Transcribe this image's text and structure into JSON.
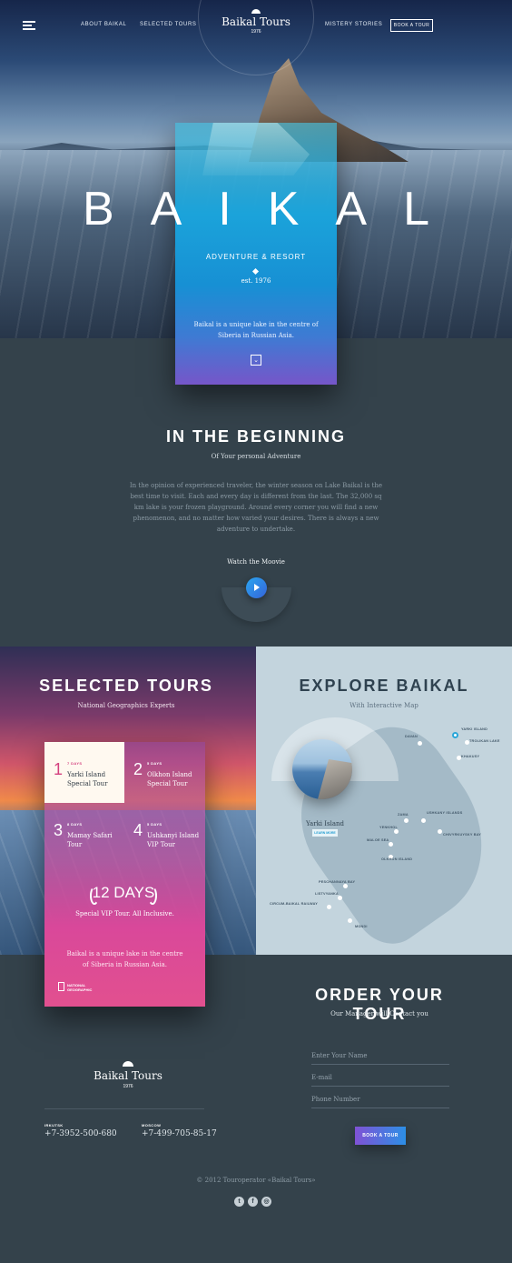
{
  "nav": {
    "links": [
      "ABOUT BAIKAL",
      "SELECTED TOURS",
      "MISTERY STORIES"
    ],
    "brand_name": "Baikal Tours",
    "brand_est": "1976",
    "book_label": "BOOK A TOUR"
  },
  "hero": {
    "title": "BAIKAL",
    "subtitle": "ADVENTURE & RESORT",
    "est": "est. 1976",
    "description": "Baikal is a unique lake in the centre of Siberia in Russian Asia."
  },
  "beginning": {
    "title": "IN THE BEGINNING",
    "subtitle": "Of Your personal Adventure",
    "text": "In the opinion of experienced traveler, the winter season on Lake Baikal is the best time to visit. Each and every day is different from the last. The 32,000 sq km lake is your frozen playground. Around every corner you will find a new phenomenon, and no matter how varied your desires. There is always a new adventure to undertake.",
    "watch_label": "Watch the Moovie"
  },
  "tours": {
    "title": "SELECTED TOURS",
    "subtitle": "National Geographics Experts",
    "items": [
      {
        "num": "1",
        "days": "7 DAYS",
        "name": "Yarki Island Special Tour"
      },
      {
        "num": "2",
        "days": "5 DAYS",
        "name": "Olkhon Island Special Tour"
      },
      {
        "num": "3",
        "days": "8 DAYS",
        "name": "Mamay Safari Tour"
      },
      {
        "num": "4",
        "days": "5 DAYS",
        "name": "Ushkanyi Island VIP Tour"
      }
    ],
    "special_days": "12 DAYS",
    "special_desc": "Special VIP Tour. All Inclusive.",
    "card_desc": "Baikal is a unique lake in the centre of Siberia in Russian Asia.",
    "natgeo": "NATIONAL GEOGRAPHIC"
  },
  "map": {
    "title": "EXPLORE BAIKAL",
    "subtitle": "With Interactive Map",
    "photo_label": "Yarki Island",
    "learn_more": "LEARN MORE",
    "places": [
      "YARKI ISLAND",
      "DAVAN",
      "TROLIKAN LAKE",
      "KHAKUSY",
      "ZAMA",
      "USHKANY ISLANDS",
      "YENKHOL",
      "CHIVYRKUYSKY BAY",
      "MALOE SEA",
      "OLKHON ISLAND",
      "PESCHANNAYA BAY",
      "LISTVYANKA",
      "CIRCUM-BAIKAL RAILWAY",
      "MONDI"
    ]
  },
  "order": {
    "title": "ORDER YOUR TOUR",
    "subtitle": "Our Manager will Contact you",
    "name_placeholder": "Enter Your Name",
    "email_placeholder": "E-mail",
    "phone_placeholder": "Phone Number",
    "button": "BOOK A TOUR"
  },
  "footer": {
    "brand_name": "Baikal Tours",
    "brand_est": "1976",
    "contacts": [
      {
        "city": "IRKUTSK",
        "phone": "+7-3952-500-680"
      },
      {
        "city": "MOSCOW",
        "phone": "+7-499-705-85-17"
      }
    ],
    "copyright": "© 2012 Touroperator «Baikal Tours»",
    "social": [
      "twitter-icon",
      "facebook-icon",
      "instagram-icon"
    ]
  }
}
